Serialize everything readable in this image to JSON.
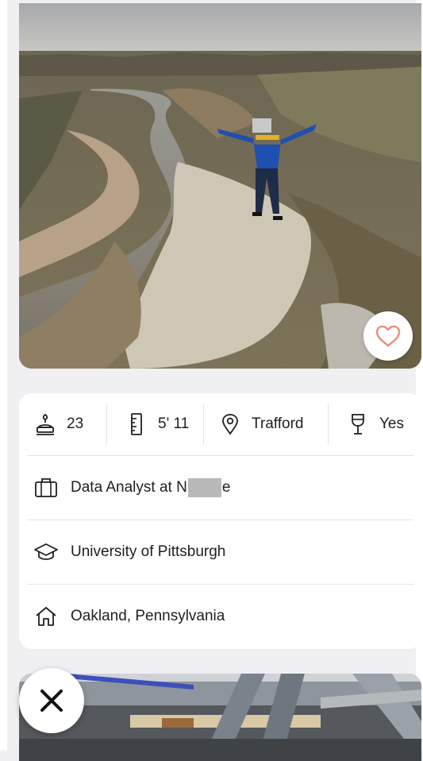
{
  "profile": {
    "vitals": {
      "age": "23",
      "height": "5' 11",
      "location": "Trafford",
      "drinking": "Yes"
    },
    "job_prefix": "Data Analyst at ",
    "job_suffix": "e",
    "education": "University of Pittsburgh",
    "hometown": "Oakland, Pennsylvania"
  },
  "icons": {
    "like": "heart-outline-icon",
    "pass": "close-x-icon",
    "age": "age-cake-icon",
    "height": "ruler-icon",
    "location": "map-pin-icon",
    "drinking": "wine-glass-icon",
    "job": "briefcase-icon",
    "education": "graduation-cap-icon",
    "hometown": "house-icon"
  },
  "colors": {
    "background": "#f0eff2",
    "card": "#ffffff",
    "divider": "#e4e4e6",
    "like_icon": "#e8957f",
    "text": "#1f1f1f"
  }
}
